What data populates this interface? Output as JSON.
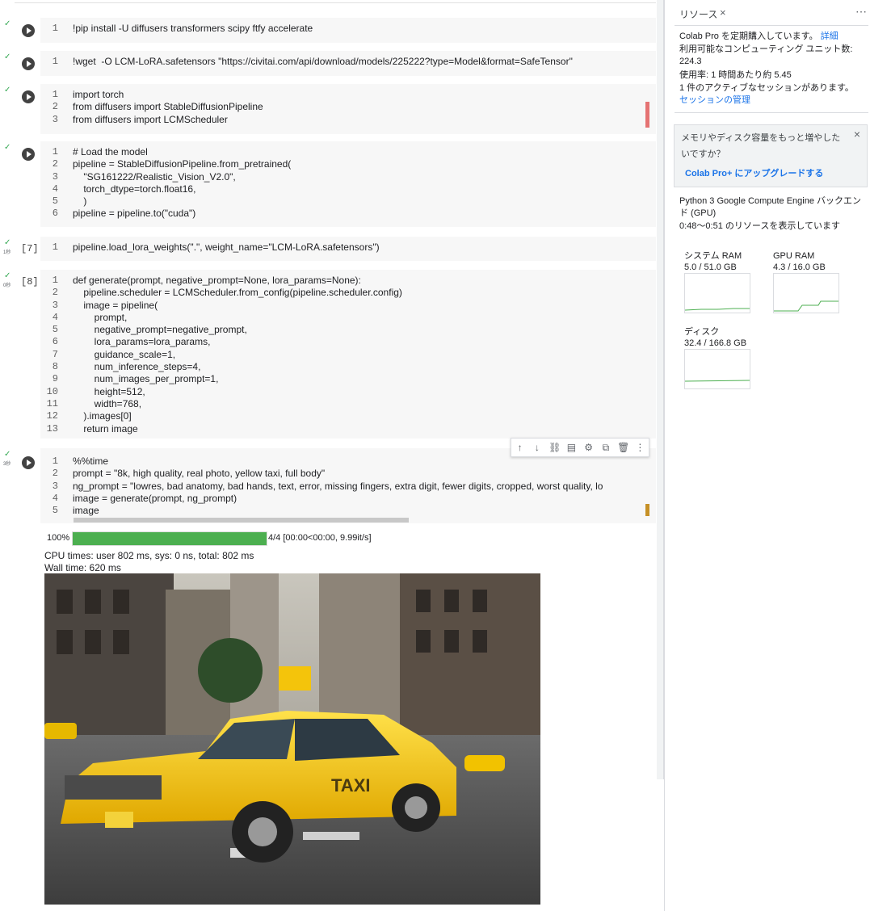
{
  "cells": [
    {
      "status": "✓",
      "duration": "",
      "exec": "",
      "lines": [
        "!pip install -U diffusers transformers scipy ftfy accelerate"
      ]
    },
    {
      "status": "✓",
      "duration": "",
      "exec": "",
      "lines": [
        "!wget  -O LCM-LoRA.safetensors \"https://civitai.com/api/download/models/225222?type=Model&format=SafeTensor\""
      ]
    },
    {
      "status": "✓",
      "duration": "",
      "exec": "",
      "lines": [
        "import torch",
        "from diffusers import StableDiffusionPipeline",
        "from diffusers import LCMScheduler"
      ]
    },
    {
      "status": "✓",
      "duration": "",
      "exec": "",
      "lines": [
        "# Load the model",
        "pipeline = StableDiffusionPipeline.from_pretrained(",
        "    \"SG161222/Realistic_Vision_V2.0\",",
        "    torch_dtype=torch.float16,",
        "    )",
        "pipeline = pipeline.to(\"cuda\")"
      ]
    },
    {
      "status": "✓",
      "duration": "1秒",
      "exec": "[7]",
      "lines": [
        "pipeline.load_lora_weights(\".\", weight_name=\"LCM-LoRA.safetensors\")"
      ]
    },
    {
      "status": "✓",
      "duration": "0秒",
      "exec": "[8]",
      "lines": [
        "def generate(prompt, negative_prompt=None, lora_params=None):",
        "    pipeline.scheduler = LCMScheduler.from_config(pipeline.scheduler.config)",
        "    image = pipeline(",
        "        prompt,",
        "        negative_prompt=negative_prompt,",
        "        lora_params=lora_params,",
        "        guidance_scale=1,",
        "        num_inference_steps=4,",
        "        num_images_per_prompt=1,",
        "        height=512,",
        "        width=768,",
        "    ).images[0]",
        "    return image"
      ]
    },
    {
      "status": "✓",
      "duration": "3秒",
      "exec": "",
      "lines": [
        "%%time",
        "prompt = \"8k, high quality, real photo, yellow taxi, full body\"",
        "ng_prompt = \"lowres, bad anatomy, bad hands, text, error, missing fingers, extra digit, fewer digits, cropped, worst quality, lo",
        "image = generate(prompt, ng_prompt)",
        "image"
      ]
    }
  ],
  "output": {
    "percent": "100%",
    "progress": 1.0,
    "stat": "4/4 [00:00<00:00, 9.99it/s]",
    "cpu": "CPU times: user 802 ms, sys: 0 ns, total: 802 ms",
    "wall": "Wall time: 620 ms",
    "image_alt": "yellow taxi",
    "image_text": "TAXI"
  },
  "toolbar": [
    "↑",
    "↓",
    "⛓",
    "▤",
    "⚙",
    "⧉",
    "🗑",
    "⋮"
  ],
  "panel": {
    "tab": "リソース",
    "close": "×",
    "more": "⋯",
    "sub_text": "Colab Pro を定期購入しています。",
    "sub_link": "詳細",
    "units_label": "利用可能なコンピューティング ユニット数:",
    "units_value": "224.3",
    "rate": "使用率: 1 時間あたり約 5.45",
    "sessions": "1 件のアクティブなセッションがあります。",
    "manage_link": "セッションの管理",
    "upgrade_text": "メモリやディスク容量をもっと増やしたいですか？",
    "upgrade_link": "Colab Pro+ にアップグレードする",
    "backend": "Python 3 Google Compute Engine バックエンド (GPU)",
    "range": "0:48〜0:51 のリソースを表示しています",
    "ram_label": "システム RAM",
    "ram_value": "5.0 / 51.0 GB",
    "gpu_label": "GPU RAM",
    "gpu_value": "4.3 / 16.0 GB",
    "disk_label": "ディスク",
    "disk_value": "32.4 / 166.8 GB"
  },
  "colors": {
    "green": "#34a853",
    "accent": "#1a73e8",
    "progress": "#4caf50"
  }
}
